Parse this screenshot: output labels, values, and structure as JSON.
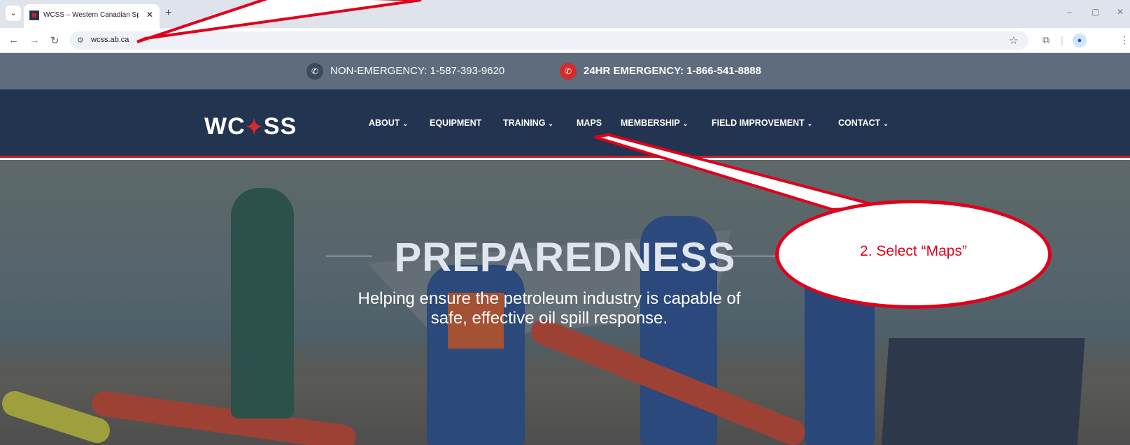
{
  "browser": {
    "tab_title": "WCSS – Western Canadian Spill",
    "tab_close": "✕",
    "new_tab": "+",
    "url": "wcss.ab.ca",
    "window_controls": {
      "minimize": "–",
      "restore": "▢",
      "close": "✕"
    }
  },
  "topbar": {
    "non_emergency": "NON-EMERGENCY: 1-587-393-9620",
    "emergency": "24HR EMERGENCY: 1-866-541-8888"
  },
  "logo": {
    "left": "WC",
    "right": "SS",
    "leaf": "✦"
  },
  "nav": {
    "items": [
      {
        "label": "ABOUT",
        "dropdown": "⌄"
      },
      {
        "label": "EQUIPMENT"
      },
      {
        "label": "TRAINING",
        "dropdown": "⌄"
      },
      {
        "label": "MAPS"
      },
      {
        "label": "MEMBERSHIP",
        "dropdown": "⌄"
      },
      {
        "label": "FIELD IMPROVEMENT",
        "dropdown": "⌄"
      },
      {
        "label": "CONTACT",
        "dropdown": "⌄"
      }
    ]
  },
  "hero": {
    "title": "PREPAREDNESS",
    "subtitle_line1": "Helping ensure the petroleum industry is capable of",
    "subtitle_line2": "safe, effective oil spill response."
  },
  "annotation": {
    "callout_text": "2. Select “Maps”",
    "color": "#e0001b"
  }
}
